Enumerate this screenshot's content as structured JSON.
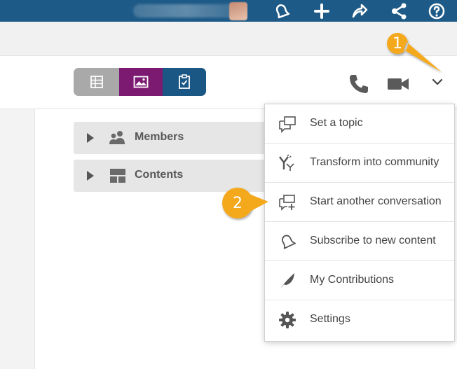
{
  "topbar": {
    "icons": [
      "bell-icon",
      "plus-icon",
      "share-icon",
      "network-icon",
      "help-icon"
    ]
  },
  "toolbar": {
    "segments": [
      "grid-icon",
      "image-icon",
      "clipboard-check-icon"
    ],
    "actions": [
      "phone-icon",
      "video-camera-icon",
      "chevron-down-icon"
    ]
  },
  "panels": [
    {
      "label": "Members",
      "icon": "members-icon"
    },
    {
      "label": "Contents",
      "icon": "contents-icon"
    }
  ],
  "menu": {
    "items": [
      {
        "label": "Set a topic",
        "icon": "speech-bubble-icon"
      },
      {
        "label": "Transform into community",
        "icon": "transform-icon"
      },
      {
        "label": "Start another conversation",
        "icon": "new-conversation-icon"
      },
      {
        "label": "Subscribe to new content",
        "icon": "bell-icon"
      },
      {
        "label": "My Contributions",
        "icon": "feather-icon"
      },
      {
        "label": "Settings",
        "icon": "gear-icon"
      }
    ]
  },
  "callouts": [
    {
      "number": "1"
    },
    {
      "number": "2"
    }
  ],
  "colors": {
    "topbar": "#1e5a87",
    "callout": "#f4a81c",
    "segment_purple": "#7c1a72",
    "segment_blue": "#1a5784",
    "segment_grey": "#a9a9a9"
  }
}
